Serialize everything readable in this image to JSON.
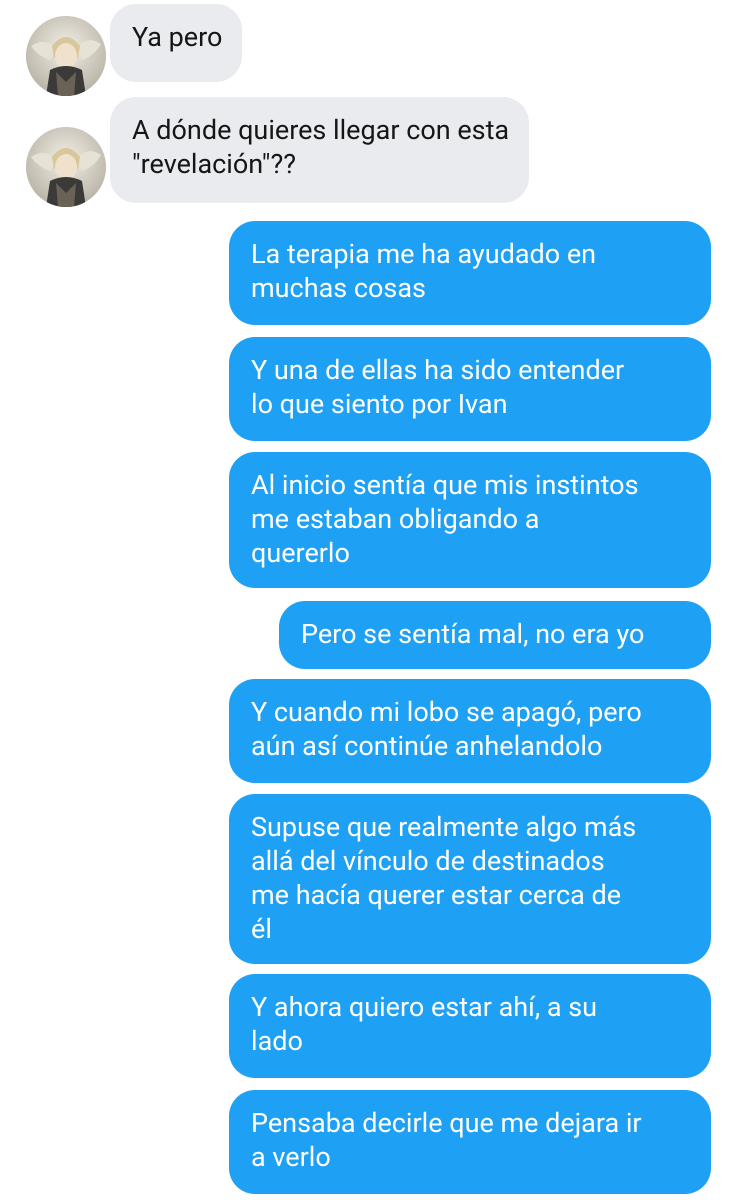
{
  "contact": {
    "avatar_icon": "character-avatar-icon"
  },
  "messages": [
    {
      "direction": "received",
      "text": "Ya pero"
    },
    {
      "direction": "received",
      "text": "A dónde quieres llegar con esta\n\"revelación\"??"
    },
    {
      "direction": "sent",
      "text": "La terapia me ha ayudado en\nmuchas cosas"
    },
    {
      "direction": "sent",
      "text": "Y una de ellas ha sido entender\nlo que siento por Ivan"
    },
    {
      "direction": "sent",
      "text": "Al inicio sentía que mis instintos\nme estaban obligando a\nquererlo"
    },
    {
      "direction": "sent",
      "text": "Pero se sentía mal, no era yo"
    },
    {
      "direction": "sent",
      "text": "Y cuando mi lobo se apagó, pero\naún así continúe anhelandolo"
    },
    {
      "direction": "sent",
      "text": "Supuse que realmente algo más\nallá del vínculo de destinados\nme hacía querer estar cerca de\nél"
    },
    {
      "direction": "sent",
      "text": "Y ahora quiero estar ahí, a su\nlado"
    },
    {
      "direction": "sent",
      "text": "Pensaba decirle que me dejara ir\na verlo"
    }
  ],
  "colors": {
    "sent_bubble": "#1ea1f5",
    "received_bubble": "#e9ebee",
    "sent_text": "#ffffff",
    "received_text": "#161616"
  }
}
